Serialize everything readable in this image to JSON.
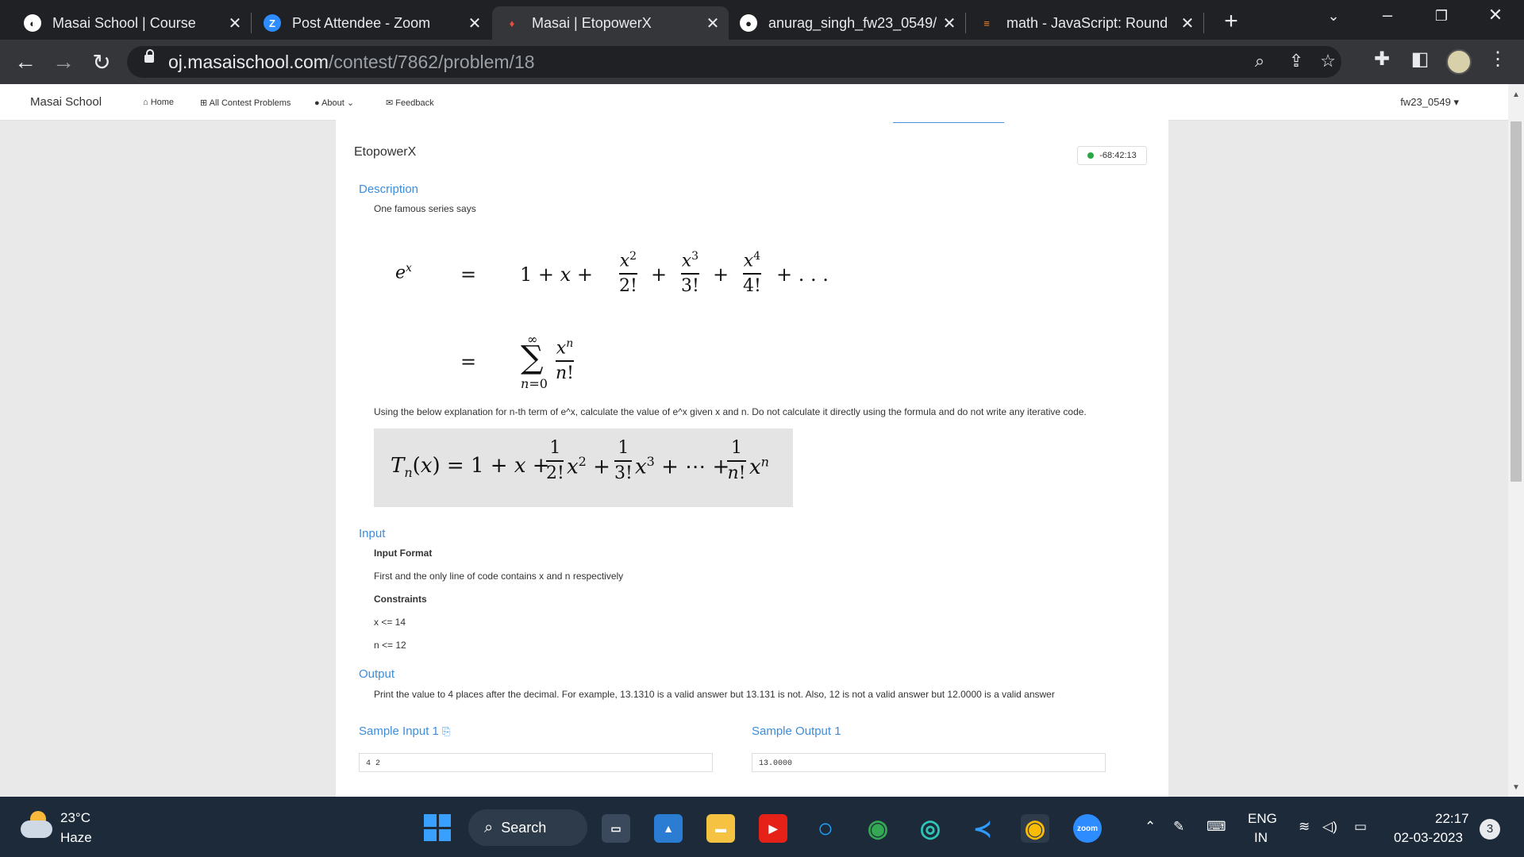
{
  "browser": {
    "tabs": [
      {
        "title": "Masai School | Course",
        "icon": "globe-icon",
        "active": false
      },
      {
        "title": "Post Attendee - Zoom",
        "icon": "zoom-icon",
        "active": false
      },
      {
        "title": "Masai | EtopowerX",
        "icon": "masai-icon",
        "active": true
      },
      {
        "title": "anurag_singh_fw23_0549/",
        "icon": "github-icon",
        "active": false
      },
      {
        "title": "math - JavaScript: Round",
        "icon": "stackoverflow-icon",
        "active": false
      }
    ],
    "url_host": "oj.masaischool.com",
    "url_path": "/contest/7862/problem/18"
  },
  "site": {
    "brand": "Masai School",
    "nav": [
      "Home",
      "All Contest Problems",
      "About",
      "Feedback"
    ],
    "user": "fw23_0549"
  },
  "problem": {
    "title": "EtopowerX",
    "timer": "-68:42:13",
    "description_heading": "Description",
    "description_intro": "One famous series says",
    "instruction": "Using the below explanation for n-th term of e^x, calculate the value of e^x given x and n. Do not calculate it directly using the formula and do not write any iterative code.",
    "input_heading": "Input",
    "input_format_heading": "Input Format",
    "input_format": "First and the only line of code contains x and n respectively",
    "constraints_heading": "Constraints",
    "constraints": [
      "x <= 14",
      "n <= 12"
    ],
    "output_heading": "Output",
    "output_text": "Print the value to 4 places after the decimal. For example, 13.1310 is a valid answer but 13.131 is not. Also, 12 is not a valid answer but 12.0000 is a valid answer",
    "sample_input_label": "Sample Input 1",
    "sample_input": "4 2",
    "sample_output_label": "Sample Output 1",
    "sample_output": "13.0000"
  },
  "taskbar": {
    "temperature": "23°C",
    "weather": "Haze",
    "search_label": "Search",
    "lang_top": "ENG",
    "lang_bottom": "IN",
    "time": "22:17",
    "date": "02-03-2023",
    "notifications": "3"
  }
}
